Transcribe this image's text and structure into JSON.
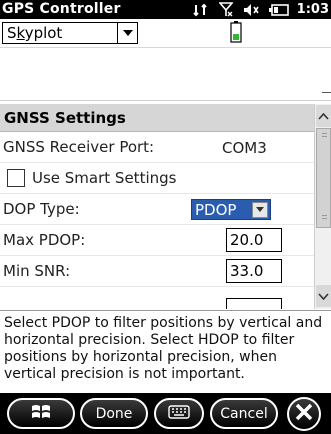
{
  "app": {
    "title": "GPS Controller",
    "clock": "1:03"
  },
  "status_icons": [
    "connectivity-icon",
    "no-signal-icon",
    "volume-icon",
    "battery-status-icon"
  ],
  "toolbar": {
    "view_select_value": "Skyplot",
    "battery_icon": "battery-icon"
  },
  "settings": {
    "section_title": "GNSS Settings",
    "receiver_port_label": "GNSS Receiver Port:",
    "receiver_port_value": "COM3",
    "smart_settings_label": "Use Smart Settings",
    "smart_settings_checked": false,
    "dop_type_label": "DOP Type:",
    "dop_type_value": "PDOP",
    "max_pdop_label": "Max PDOP:",
    "max_pdop_value": "20.0",
    "min_snr_label": "Min SNR:",
    "min_snr_value": "33.0"
  },
  "help_text": "Select PDOP to filter positions by vertical and horizontal precision. Select HDOP to filter positions by horizontal precision, when vertical precision is not important.",
  "bottombar": {
    "start_icon": "windows-start-icon",
    "done_label": "Done",
    "keyboard_icon": "keyboard-icon",
    "cancel_label": "Cancel",
    "close_icon": "close-icon"
  },
  "colors": {
    "selection_blue": "#2a5db0",
    "header_gray": "#d6d6d6",
    "bar_black": "#000000"
  }
}
